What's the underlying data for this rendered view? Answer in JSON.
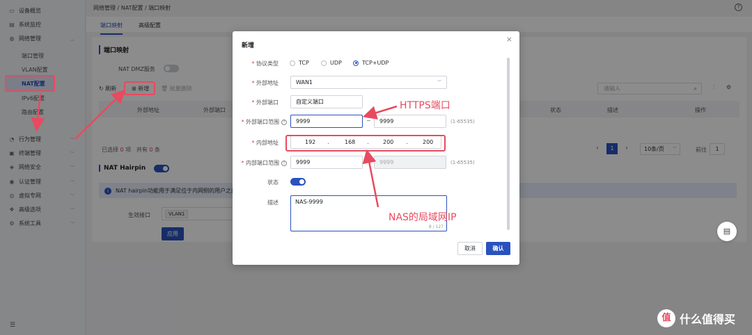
{
  "sidebar": {
    "items": [
      {
        "label": "设备概览",
        "icon": "monitor-icon"
      },
      {
        "label": "系统监控",
        "icon": "chart-icon"
      },
      {
        "label": "网络管理",
        "icon": "globe-icon"
      },
      {
        "label": "行为管理",
        "icon": "behavior-icon"
      },
      {
        "label": "终端管理",
        "icon": "terminal-icon"
      },
      {
        "label": "网络安全",
        "icon": "shield-icon"
      },
      {
        "label": "认证管理",
        "icon": "auth-icon"
      },
      {
        "label": "虚拟专网",
        "icon": "vpn-icon"
      },
      {
        "label": "高级选项",
        "icon": "advanced-icon"
      },
      {
        "label": "系统工具",
        "icon": "tools-icon"
      }
    ],
    "network_sub": [
      "端口管理",
      "VLAN配置",
      "NAT配置",
      "IPv6配置",
      "路由配置"
    ]
  },
  "main": {
    "breadcrumb": "网络管理 / NAT配置 / 端口映射",
    "tabs": [
      "端口映射",
      "高级配置"
    ],
    "section_title": "端口映射",
    "dmz_label": "NAT DMZ服务",
    "refresh": "刷新",
    "add": "新增",
    "batch_delete": "批量删除",
    "search_placeholder": "请输入",
    "columns": [
      "外部地址",
      "外部端口",
      "状态",
      "描述",
      "操作"
    ],
    "selected_prefix": "已选择",
    "selected_count": "0",
    "selected_unit": "项",
    "total_prefix": "共有",
    "total_count": "0",
    "total_unit": "条",
    "current_page": "1",
    "page_size": "10条/页",
    "goto_label": "前往",
    "goto_page": "1",
    "hairpin_title": "NAT Hairpin",
    "hairpin_info": "NAT hairpin功能用于满足位于内网侧的用户之间",
    "effective_if_label": "生效接口",
    "effective_if_value": "VLAN1",
    "apply": "应用"
  },
  "dialog": {
    "title": "新增",
    "protocol_label": "协议类型",
    "protocols": [
      "TCP",
      "UDP",
      "TCP+UDP"
    ],
    "protocol_selected": "TCP+UDP",
    "ext_addr_label": "外部地址",
    "ext_addr_value": "WAN1",
    "ext_port_label": "外部端口",
    "ext_port_value": "自定义端口",
    "ext_range_label": "外部端口范围",
    "ext_range_from": "9999",
    "ext_range_tilde": "~",
    "ext_range_to": "9999",
    "range_hint": "(1-65535)",
    "int_addr_label": "内部地址",
    "ip": [
      "192",
      "168",
      "200",
      "200"
    ],
    "int_range_label": "内部端口范围",
    "int_range_from": "9999",
    "int_range_to": "9999",
    "status_label": "状态",
    "desc_label": "描述",
    "desc_value": "NAS-9999",
    "desc_counter": "8 / 127",
    "cancel": "取消",
    "confirm": "确认"
  },
  "annotations": {
    "https_port": "HTTPS端口",
    "nas_ip": "NAS的局域网IP"
  },
  "watermark": {
    "logo": "值",
    "text": "什么值得买"
  },
  "colors": {
    "accent": "#2a52be",
    "annotation": "#e84a5f"
  }
}
